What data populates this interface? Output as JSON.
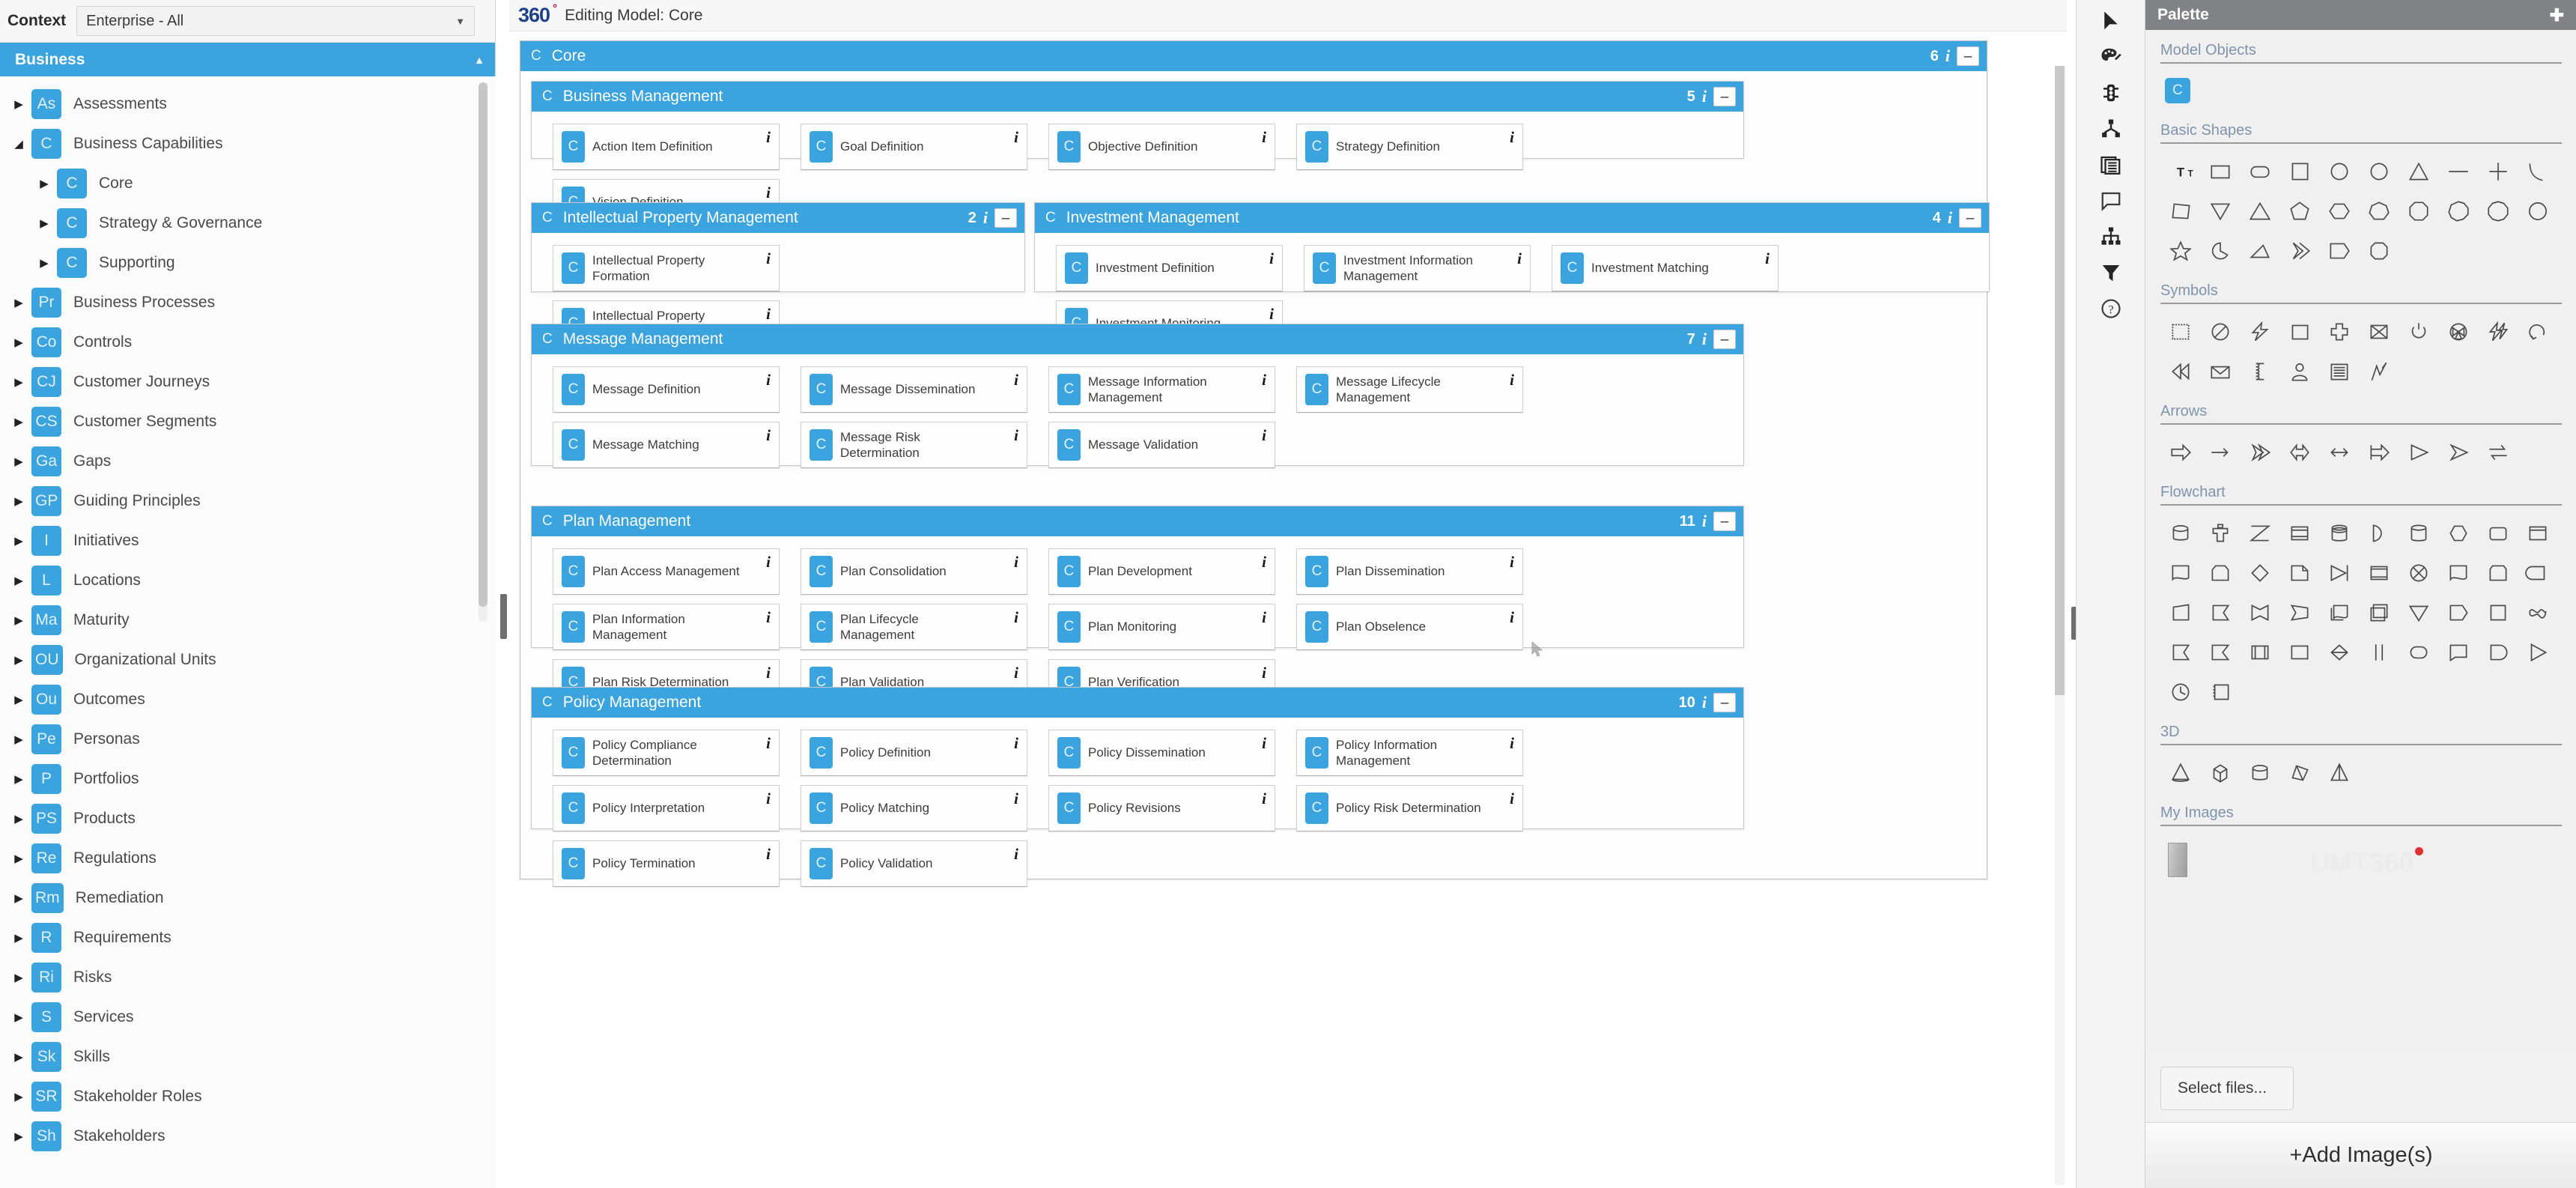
{
  "context": {
    "label": "Context",
    "selected": "Enterprise - All",
    "caret_icon": "chevron-down-icon"
  },
  "sidebar": {
    "header": {
      "title": "Business",
      "collapse_icon": "triangle-up-icon"
    },
    "items": [
      {
        "badge": "As",
        "label": "Assessments",
        "twisty": "▶",
        "depth": 0
      },
      {
        "badge": "C",
        "label": "Business Capabilities",
        "twisty": "◢",
        "depth": 0
      },
      {
        "badge": "C",
        "label": "Core",
        "twisty": "▶",
        "depth": 1
      },
      {
        "badge": "C",
        "label": "Strategy & Governance",
        "twisty": "▶",
        "depth": 1
      },
      {
        "badge": "C",
        "label": "Supporting",
        "twisty": "▶",
        "depth": 1
      },
      {
        "badge": "Pr",
        "label": "Business Processes",
        "twisty": "▶",
        "depth": 0
      },
      {
        "badge": "Co",
        "label": "Controls",
        "twisty": "▶",
        "depth": 0
      },
      {
        "badge": "CJ",
        "label": "Customer Journeys",
        "twisty": "▶",
        "depth": 0
      },
      {
        "badge": "CS",
        "label": "Customer Segments",
        "twisty": "▶",
        "depth": 0
      },
      {
        "badge": "Ga",
        "label": "Gaps",
        "twisty": "▶",
        "depth": 0
      },
      {
        "badge": "GP",
        "label": "Guiding Principles",
        "twisty": "▶",
        "depth": 0
      },
      {
        "badge": "I",
        "label": "Initiatives",
        "twisty": "▶",
        "depth": 0
      },
      {
        "badge": "L",
        "label": "Locations",
        "twisty": "▶",
        "depth": 0
      },
      {
        "badge": "Ma",
        "label": "Maturity",
        "twisty": "▶",
        "depth": 0
      },
      {
        "badge": "OU",
        "label": "Organizational Units",
        "twisty": "▶",
        "depth": 0
      },
      {
        "badge": "Ou",
        "label": "Outcomes",
        "twisty": "▶",
        "depth": 0
      },
      {
        "badge": "Pe",
        "label": "Personas",
        "twisty": "▶",
        "depth": 0
      },
      {
        "badge": "P",
        "label": "Portfolios",
        "twisty": "▶",
        "depth": 0
      },
      {
        "badge": "PS",
        "label": "Products",
        "twisty": "▶",
        "depth": 0
      },
      {
        "badge": "Re",
        "label": "Regulations",
        "twisty": "▶",
        "depth": 0
      },
      {
        "badge": "Rm",
        "label": "Remediation",
        "twisty": "▶",
        "depth": 0
      },
      {
        "badge": "R",
        "label": "Requirements",
        "twisty": "▶",
        "depth": 0
      },
      {
        "badge": "Ri",
        "label": "Risks",
        "twisty": "▶",
        "depth": 0
      },
      {
        "badge": "S",
        "label": "Services",
        "twisty": "▶",
        "depth": 0
      },
      {
        "badge": "Sk",
        "label": "Skills",
        "twisty": "▶",
        "depth": 0
      },
      {
        "badge": "SR",
        "label": "Stakeholder Roles",
        "twisty": "▶",
        "depth": 0
      },
      {
        "badge": "Sh",
        "label": "Stakeholders",
        "twisty": "▶",
        "depth": 0
      }
    ]
  },
  "canvas": {
    "logo": "360",
    "logo_degree": "°",
    "title": "Editing Model: Core",
    "root": {
      "icon_letter": "C",
      "name": "Core",
      "count": "6",
      "info_icon": "info-icon",
      "collapse_label": "–"
    },
    "groups": [
      {
        "icon_letter": "C",
        "name": "Business Management",
        "count": "5",
        "collapse_label": "–",
        "nodes": [
          {
            "badge": "C",
            "label": "Action Item Definition"
          },
          {
            "badge": "C",
            "label": "Goal Definition"
          },
          {
            "badge": "C",
            "label": "Objective Definition"
          },
          {
            "badge": "C",
            "label": "Strategy Definition"
          },
          {
            "badge": "C",
            "label": "Vision Definition"
          }
        ]
      },
      {
        "icon_letter": "C",
        "name": "Intellectual Property Management",
        "count": "2",
        "collapse_label": "–",
        "nodes": [
          {
            "badge": "C",
            "label": "Intellectual Property Formation"
          },
          {
            "badge": "C",
            "label": "Intellectual Property Licensing"
          }
        ]
      },
      {
        "icon_letter": "C",
        "name": "Investment Management",
        "count": "4",
        "collapse_label": "–",
        "nodes": [
          {
            "badge": "C",
            "label": "Investment Definition"
          },
          {
            "badge": "C",
            "label": "Investment Information Management"
          },
          {
            "badge": "C",
            "label": "Investment Matching"
          },
          {
            "badge": "C",
            "label": "Investment Monitoring"
          }
        ]
      },
      {
        "icon_letter": "C",
        "name": "Message Management",
        "count": "7",
        "collapse_label": "–",
        "nodes": [
          {
            "badge": "C",
            "label": "Message Definition"
          },
          {
            "badge": "C",
            "label": "Message Dissemination"
          },
          {
            "badge": "C",
            "label": "Message Information Management"
          },
          {
            "badge": "C",
            "label": "Message Lifecycle Management"
          },
          {
            "badge": "C",
            "label": "Message Matching"
          },
          {
            "badge": "C",
            "label": "Message Risk Determination"
          },
          {
            "badge": "C",
            "label": "Message Validation"
          }
        ]
      },
      {
        "icon_letter": "C",
        "name": "Plan Management",
        "count": "11",
        "collapse_label": "–",
        "nodes": [
          {
            "badge": "C",
            "label": "Plan Access Management"
          },
          {
            "badge": "C",
            "label": "Plan Consolidation"
          },
          {
            "badge": "C",
            "label": "Plan Development"
          },
          {
            "badge": "C",
            "label": "Plan Dissemination"
          },
          {
            "badge": "C",
            "label": "Plan Information Management"
          },
          {
            "badge": "C",
            "label": "Plan Lifecycle Management"
          },
          {
            "badge": "C",
            "label": "Plan Monitoring"
          },
          {
            "badge": "C",
            "label": "Plan Obselence"
          },
          {
            "badge": "C",
            "label": "Plan Risk Determination"
          },
          {
            "badge": "C",
            "label": "Plan Validation"
          },
          {
            "badge": "C",
            "label": "Plan Verification"
          }
        ]
      },
      {
        "icon_letter": "C",
        "name": "Policy Management",
        "count": "10",
        "collapse_label": "–",
        "nodes": [
          {
            "badge": "C",
            "label": "Policy Compliance Determination"
          },
          {
            "badge": "C",
            "label": "Policy Definition"
          },
          {
            "badge": "C",
            "label": "Policy Dissemination"
          },
          {
            "badge": "C",
            "label": "Policy Information Management"
          },
          {
            "badge": "C",
            "label": "Policy Interpretation"
          },
          {
            "badge": "C",
            "label": "Policy Matching"
          },
          {
            "badge": "C",
            "label": "Policy Revisions"
          },
          {
            "badge": "C",
            "label": "Policy Risk Determination"
          },
          {
            "badge": "C",
            "label": "Policy Termination"
          },
          {
            "badge": "C",
            "label": "Policy Validation"
          }
        ]
      }
    ]
  },
  "toolbar": {
    "items": [
      {
        "icon": "play-cursor-icon"
      },
      {
        "icon": "palette-brush-icon"
      },
      {
        "icon": "traffic-light-icon"
      },
      {
        "icon": "relationship-node-icon"
      },
      {
        "icon": "list-layers-icon"
      },
      {
        "icon": "comment-icon"
      },
      {
        "icon": "hierarchy-icon"
      },
      {
        "icon": "filter-funnel-icon"
      },
      {
        "icon": "help-circle-icon"
      }
    ]
  },
  "palette": {
    "title": "Palette",
    "pin_icon": "pin-icon",
    "sections": [
      {
        "name": "Model Objects",
        "kind": "model",
        "items": [
          {
            "badge": "C"
          }
        ]
      },
      {
        "name": "Basic Shapes",
        "kind": "shapes",
        "count": 27
      },
      {
        "name": "Symbols",
        "kind": "shapes",
        "count": 16
      },
      {
        "name": "Arrows",
        "kind": "shapes",
        "count": 9
      },
      {
        "name": "Flowchart",
        "kind": "shapes",
        "count": 42
      },
      {
        "name": "3D",
        "kind": "shapes",
        "count": 5
      },
      {
        "name": "My Images",
        "kind": "images"
      }
    ],
    "watermark": "UMT360",
    "select_files_label": "Select files...",
    "add_images_label": "+Add Image(s)"
  },
  "colors": {
    "accent": "#3ba3dd",
    "palette_header": "#808285",
    "logo_blue": "#1f3f8f",
    "logo_red": "#c8102e",
    "section_title": "#7f93ad"
  }
}
